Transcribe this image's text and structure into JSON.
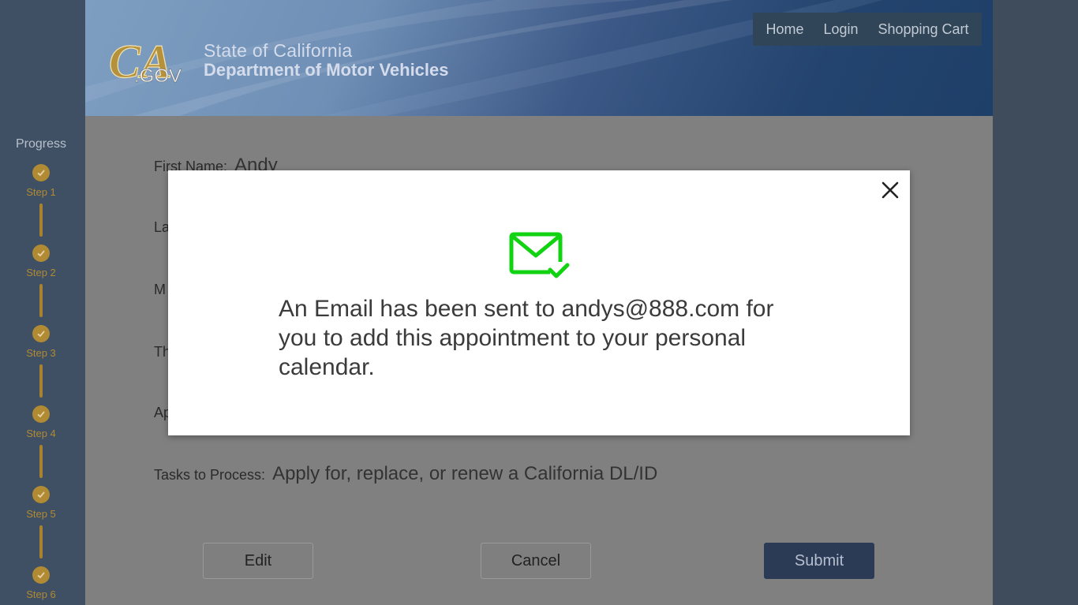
{
  "header": {
    "logo_text": "CA.GOV",
    "agency_line1": "State of California",
    "agency_line2": "Department of Motor Vehicles"
  },
  "nav": {
    "home": "Home",
    "login": "Login",
    "cart": "Shopping Cart"
  },
  "sidebar": {
    "title": "Progress",
    "steps": [
      {
        "label": "Step 1",
        "completed": true
      },
      {
        "label": "Step 2",
        "completed": true
      },
      {
        "label": "Step 3",
        "completed": true
      },
      {
        "label": "Step 4",
        "completed": true
      },
      {
        "label": "Step 5",
        "completed": true
      },
      {
        "label": "Step 6",
        "completed": true
      }
    ]
  },
  "form": {
    "first_name_label": "First Name:",
    "first_name_value": "Andy",
    "row2_label_visible": "La",
    "row3_label_visible": "M",
    "row4_label_visible": "Th",
    "row5_label_visible": "Ap",
    "tasks_label": "Tasks to Process:",
    "tasks_value": "Apply for, replace, or renew a California DL/ID"
  },
  "buttons": {
    "edit": "Edit",
    "cancel": "Cancel",
    "submit": "Submit"
  },
  "modal": {
    "message": "An Email has been sent to andys@888.com for you to add this appointment to your personal calendar."
  },
  "colors": {
    "accent_gold": "#b18a34",
    "success_green": "#12d312",
    "submit_bg": "#2b3a55",
    "header_blue": "#23446e"
  },
  "icons": {
    "close": "close-icon",
    "mail_check": "mail-check-icon",
    "step_check": "check-icon"
  }
}
